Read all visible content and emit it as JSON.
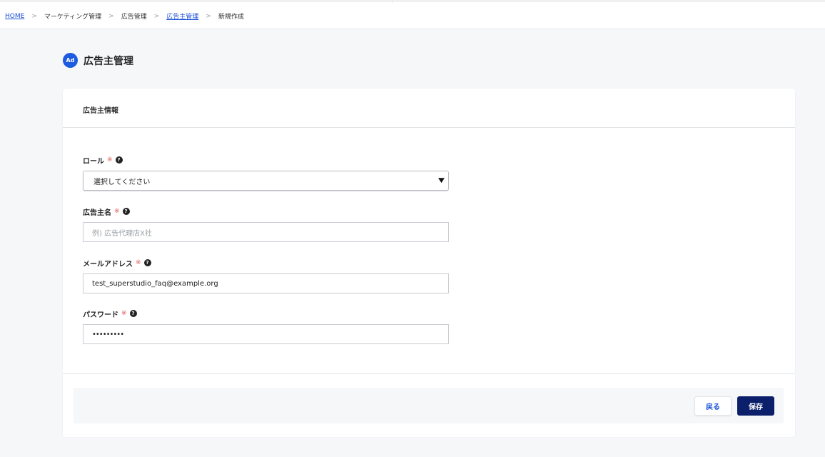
{
  "breadcrumb": {
    "items": [
      {
        "label": "HOME",
        "link": true
      },
      {
        "label": "マーケティング管理",
        "link": false
      },
      {
        "label": "広告管理",
        "link": false
      },
      {
        "label": "広告主管理",
        "link": true
      },
      {
        "label": "新規作成",
        "link": false
      }
    ],
    "separator": ">"
  },
  "page": {
    "icon_text": "Ad",
    "icon_name": "ad-icon",
    "title": "広告主管理"
  },
  "card": {
    "title": "広告主情報"
  },
  "form": {
    "required_mark": "※",
    "help_glyph": "?",
    "role": {
      "label": "ロール",
      "selected": "選択してください"
    },
    "name": {
      "label": "広告主名",
      "placeholder": "例) 広告代理店X社",
      "value": ""
    },
    "email": {
      "label": "メールアドレス",
      "value": "test_superstudio_faq@example.org"
    },
    "password": {
      "label": "パスワード",
      "value": "•••••••••"
    }
  },
  "actions": {
    "back_label": "戻る",
    "save_label": "保存"
  },
  "colors": {
    "accent_blue": "#1d5be0",
    "save_button": "#0b1f6b",
    "required": "#e05656"
  }
}
